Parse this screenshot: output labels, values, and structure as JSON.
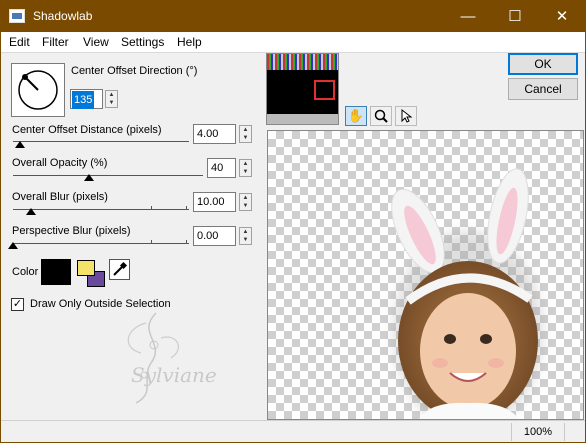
{
  "window": {
    "title": "Shadowlab",
    "minimize": "—",
    "maximize": "☐",
    "close": "✕"
  },
  "menu": [
    "Edit",
    "Filter",
    "View",
    "Settings",
    "Help"
  ],
  "direction": {
    "label": "Center Offset Direction (°)",
    "value": "135"
  },
  "distance": {
    "label": "Center Offset Distance (pixels)",
    "value": "4.00",
    "slider_fraction": 0.04
  },
  "opacity": {
    "label": "Overall Opacity (%)",
    "value": "40",
    "slider_fraction": 0.4
  },
  "blur": {
    "label": "Overall Blur (pixels)",
    "value": "10.00",
    "slider_fraction": 0.1
  },
  "perspective": {
    "label": "Perspective Blur (pixels)",
    "value": "0.00",
    "slider_fraction": 0.0
  },
  "color": {
    "label": "Color",
    "primary": "#000000",
    "secondary_fg": "#f4e26a",
    "secondary_bg": "#6a4a9c"
  },
  "draw_outside": {
    "label": "Draw Only Outside Selection",
    "checked": true,
    "mark": "✓"
  },
  "watermark": {
    "text": "Sylviane"
  },
  "buttons": {
    "ok": "OK",
    "cancel": "Cancel"
  },
  "tools": [
    "hand",
    "zoom",
    "arrow"
  ],
  "status": {
    "zoom": "100%"
  }
}
